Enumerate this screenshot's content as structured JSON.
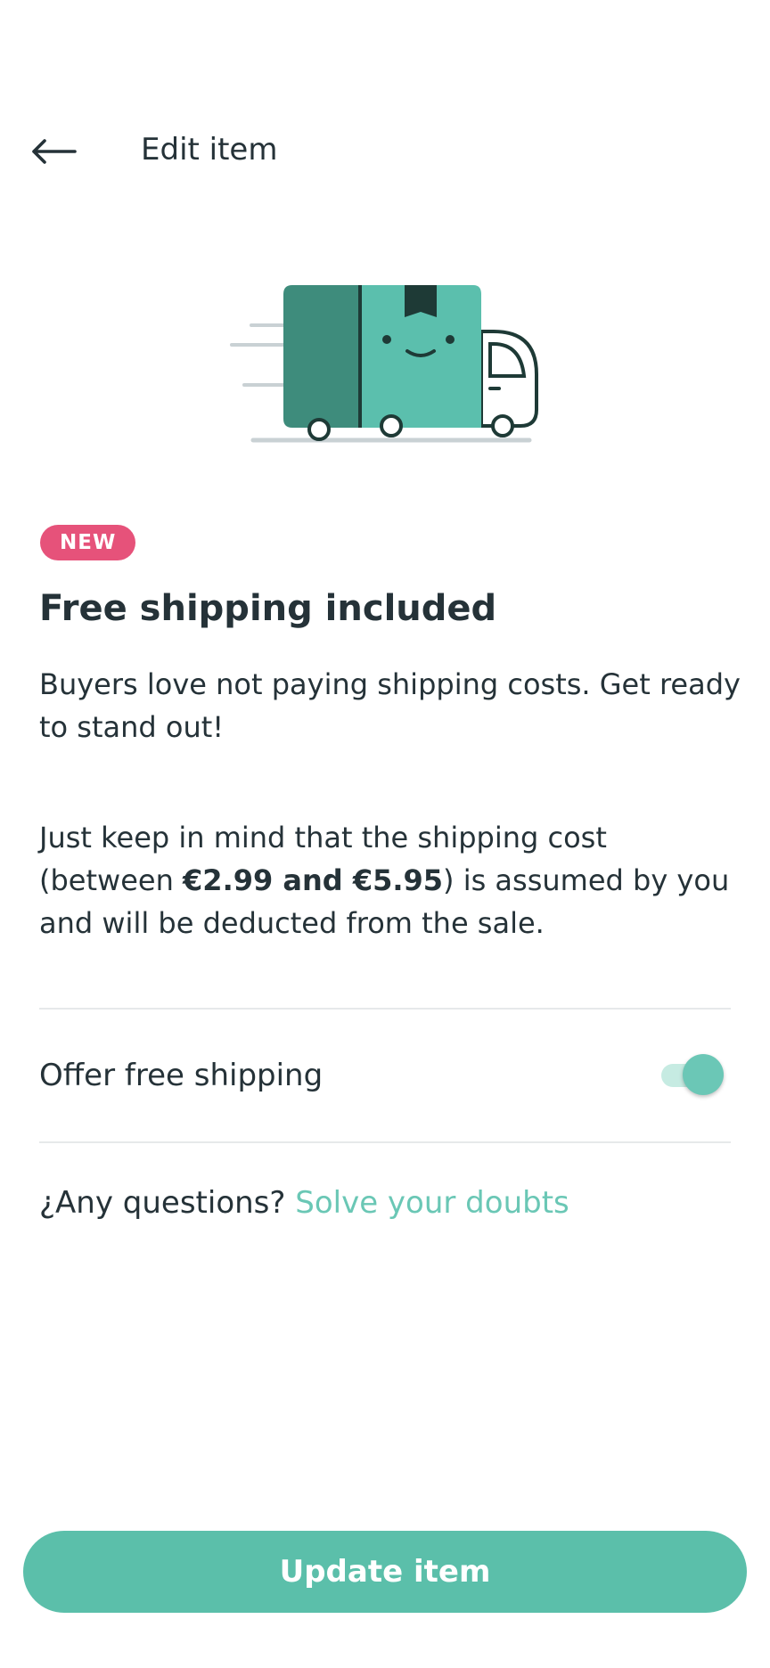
{
  "header": {
    "title": "Edit item",
    "back_icon": "arrow-left-icon"
  },
  "illustration": {
    "icon": "delivery-truck-illustration",
    "colors": {
      "box_dark": "#3e8c7c",
      "box_light": "#5bbfad",
      "outline": "#1e3a36",
      "speed_lines": "#c9d1d4"
    }
  },
  "badge": {
    "label": "NEW",
    "color": "#e6527a"
  },
  "title": "Free shipping included",
  "paragraphs": {
    "p1": "Buyers love not paying shipping costs. Get ready to stand out!",
    "p2_before": "Just keep in mind that the shipping cost (between ",
    "p2_bold": "€2.99 and €5.95",
    "p2_after": ") is assumed by you and will be deducted from the sale."
  },
  "free_shipping_toggle": {
    "label": "Offer free shipping",
    "state": "on",
    "accent": "#6bc7b6"
  },
  "faq": {
    "question": "¿Any questions?",
    "link": "Solve your doubts",
    "link_color": "#6ac7b5"
  },
  "footer": {
    "button_label": "Update item",
    "button_color": "#5bbfaa"
  }
}
